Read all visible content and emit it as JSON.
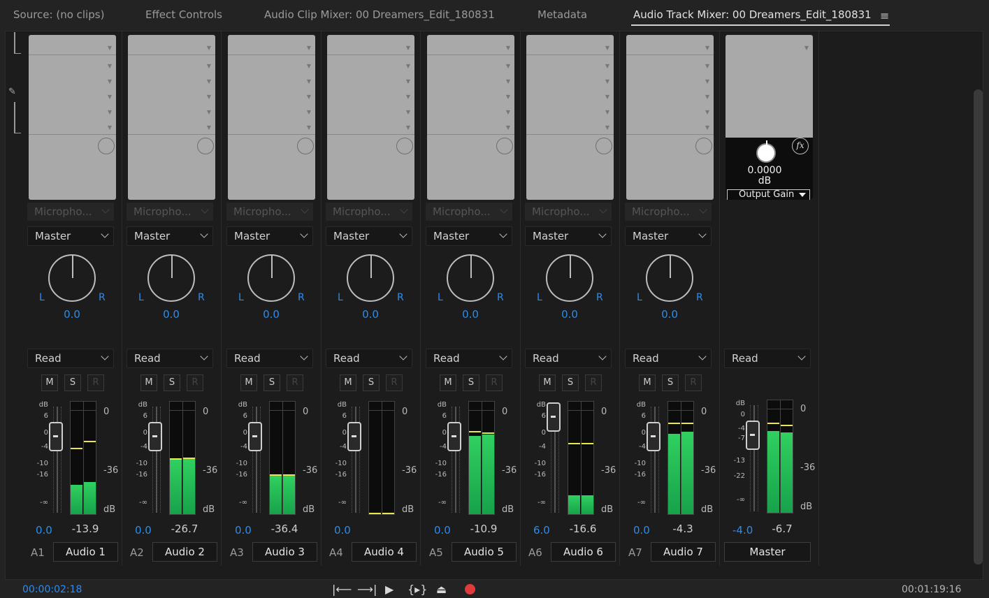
{
  "tabs": [
    {
      "label": "Source: (no clips)"
    },
    {
      "label": "Effect Controls"
    },
    {
      "label": "Audio Clip Mixer: 00 Dreamers_Edit_180831"
    },
    {
      "label": "Metadata"
    },
    {
      "label": "Audio Track Mixer: 00 Dreamers_Edit_180831"
    }
  ],
  "menu_icon": "hamburger-icon",
  "tracks": [
    {
      "id": "A1",
      "name": "Audio 1",
      "input": "Micropho...",
      "output": "Master",
      "pan_l": "L",
      "pan_r": "R",
      "pan": "0.0",
      "mode": "Read",
      "m": "M",
      "s": "S",
      "r": "R",
      "volume": "0.0",
      "peak": "-13.9",
      "meter_l": 0.28,
      "meter_r": 0.31,
      "peak_marks": [
        0.62,
        0.69
      ]
    },
    {
      "id": "A2",
      "name": "Audio 2",
      "input": "Micropho...",
      "output": "Master",
      "pan_l": "L",
      "pan_r": "R",
      "pan": "0.0",
      "mode": "Read",
      "m": "M",
      "s": "S",
      "r": "R",
      "volume": "0.0",
      "peak": "-26.7",
      "meter_l": 0.52,
      "meter_r": 0.53,
      "peak_marks": [
        0.52,
        0.53
      ]
    },
    {
      "id": "A3",
      "name": "Audio 3",
      "input": "Micropho...",
      "output": "Master",
      "pan_l": "L",
      "pan_r": "R",
      "pan": "0.0",
      "mode": "Read",
      "m": "M",
      "s": "S",
      "r": "R",
      "volume": "0.0",
      "peak": "-36.4",
      "meter_l": 0.37,
      "meter_r": 0.37,
      "peak_marks": [
        0.37,
        0.37
      ]
    },
    {
      "id": "A4",
      "name": "Audio 4",
      "input": "Micropho...",
      "output": "Master",
      "pan_l": "L",
      "pan_r": "R",
      "pan": "0.0",
      "mode": "Read",
      "m": "M",
      "s": "S",
      "r": "R",
      "volume": "0.0",
      "peak": "",
      "meter_l": 0,
      "meter_r": 0,
      "peak_marks": [
        0.0,
        0.0
      ]
    },
    {
      "id": "A5",
      "name": "Audio 5",
      "input": "Micropho...",
      "output": "Master",
      "pan_l": "L",
      "pan_r": "R",
      "pan": "0.0",
      "mode": "Read",
      "m": "M",
      "s": "S",
      "r": "R",
      "volume": "0.0",
      "peak": "-10.9",
      "meter_l": 0.75,
      "meter_r": 0.76,
      "peak_marks": [
        0.78,
        0.77
      ]
    },
    {
      "id": "A6",
      "name": "Audio 6",
      "input": "Micropho...",
      "output": "Master",
      "pan_l": "L",
      "pan_r": "R",
      "pan": "0.0",
      "mode": "Read",
      "m": "M",
      "s": "S",
      "r": "R",
      "volume": "6.0",
      "peak": "-16.6",
      "meter_l": 0.18,
      "meter_r": 0.18,
      "peak_marks": [
        0.67,
        0.67
      ]
    },
    {
      "id": "A7",
      "name": "Audio 7",
      "input": "Micropho...",
      "output": "Master",
      "pan_l": "L",
      "pan_r": "R",
      "pan": "0.0",
      "mode": "Read",
      "m": "M",
      "s": "S",
      "r": "R",
      "volume": "0.0",
      "peak": "-4.3",
      "meter_l": 0.77,
      "meter_r": 0.79,
      "peak_marks": [
        0.86,
        0.86
      ]
    }
  ],
  "master": {
    "name": "Master",
    "mode": "Read",
    "volume": "-4.0",
    "peak": "-6.7",
    "gain_value": "0.0000",
    "gain_unit": "dB",
    "gain_param": "Output Gain",
    "fx_label": "fx",
    "meter_l": 0.78,
    "meter_r": 0.77,
    "peak_marks": [
      0.85,
      0.83
    ]
  },
  "fader_scale": [
    "dB",
    "6",
    "0",
    "-4",
    "-10",
    "-16",
    "-∞"
  ],
  "master_fader_scale": [
    "dB",
    "0",
    "-4",
    "-7",
    "-13",
    "-22",
    "-∞"
  ],
  "meter_scale": [
    "0",
    "-36",
    "dB"
  ],
  "footer": {
    "timecode_in": "00:00:02:18",
    "timecode_out": "00:01:19:16"
  },
  "colors": {
    "accent": "#2d8ceb",
    "meter": "#1fb855",
    "peak": "#e8e84a",
    "record": "#e03a3a"
  }
}
